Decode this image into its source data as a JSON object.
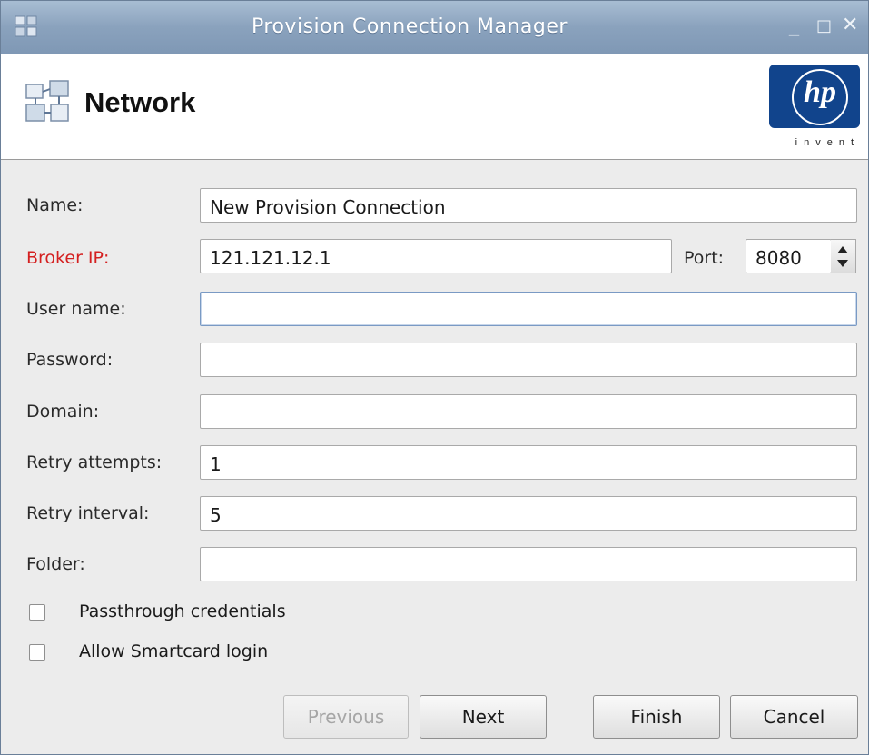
{
  "window": {
    "title": "Provision Connection Manager",
    "controls": {
      "minimize": "_",
      "maximize": "□",
      "close": "✕"
    }
  },
  "header": {
    "heading": "Network",
    "logo": {
      "mark": "hp",
      "tagline": "invent",
      "color": "#11448c"
    }
  },
  "form": {
    "name": {
      "label": "Name:",
      "value": "New Provision Connection"
    },
    "broker_ip": {
      "label": "Broker IP:",
      "value": "121.121.12.1",
      "label_color": "#d42020"
    },
    "port": {
      "label": "Port:",
      "value": "8080"
    },
    "user_name": {
      "label": "User name:",
      "value": ""
    },
    "password": {
      "label": "Password:",
      "value": ""
    },
    "domain": {
      "label": "Domain:",
      "value": ""
    },
    "retry_attempts": {
      "label": "Retry attempts:",
      "value": "1"
    },
    "retry_interval": {
      "label": "Retry interval:",
      "value": "5"
    },
    "folder": {
      "label": "Folder:",
      "value": ""
    }
  },
  "options": {
    "passthrough": {
      "label": "Passthrough credentials",
      "checked": false
    },
    "smartcard": {
      "label": "Allow Smartcard login",
      "checked": false
    }
  },
  "buttons": {
    "previous": "Previous",
    "next": "Next",
    "finish": "Finish",
    "cancel": "Cancel"
  }
}
